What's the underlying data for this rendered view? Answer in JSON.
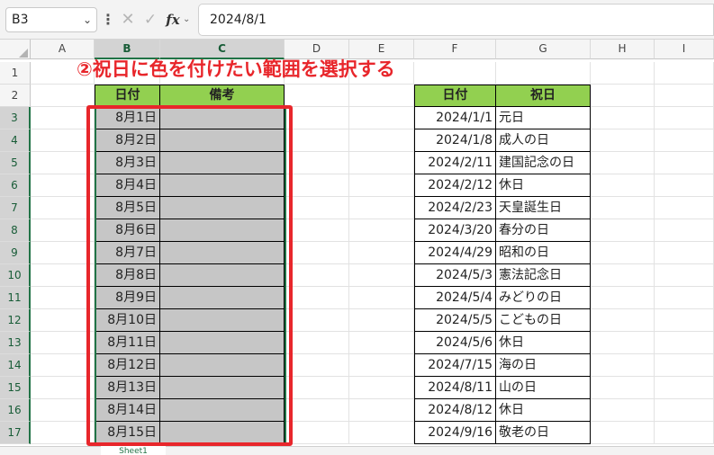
{
  "formula_bar": {
    "name_box": "B3",
    "formula": "2024/8/1",
    "fx_label": "fx"
  },
  "columns": [
    "A",
    "B",
    "C",
    "D",
    "E",
    "F",
    "G",
    "H",
    "I"
  ],
  "rows": [
    "1",
    "2",
    "3",
    "4",
    "5",
    "6",
    "7",
    "8",
    "9",
    "10",
    "11",
    "12",
    "13",
    "14",
    "15",
    "16",
    "17"
  ],
  "annotation": "②祝日に色を付けたい範囲を選択する",
  "left_table": {
    "headers": [
      "日付",
      "備考"
    ],
    "dates": [
      "8月1日",
      "8月2日",
      "8月3日",
      "8月4日",
      "8月5日",
      "8月6日",
      "8月7日",
      "8月8日",
      "8月9日",
      "8月10日",
      "8月11日",
      "8月12日",
      "8月13日",
      "8月14日",
      "8月15日"
    ]
  },
  "right_table": {
    "headers": [
      "日付",
      "祝日"
    ],
    "rows": [
      {
        "date": "2024/1/1",
        "name": "元日"
      },
      {
        "date": "2024/1/8",
        "name": "成人の日"
      },
      {
        "date": "2024/2/11",
        "name": "建国記念の日"
      },
      {
        "date": "2024/2/12",
        "name": "休日"
      },
      {
        "date": "2024/2/23",
        "name": "天皇誕生日"
      },
      {
        "date": "2024/3/20",
        "name": "春分の日"
      },
      {
        "date": "2024/4/29",
        "name": "昭和の日"
      },
      {
        "date": "2024/5/3",
        "name": "憲法記念日"
      },
      {
        "date": "2024/5/4",
        "name": "みどりの日"
      },
      {
        "date": "2024/5/5",
        "name": "こどもの日"
      },
      {
        "date": "2024/5/6",
        "name": "休日"
      },
      {
        "date": "2024/7/15",
        "name": "海の日"
      },
      {
        "date": "2024/8/11",
        "name": "山の日"
      },
      {
        "date": "2024/8/12",
        "name": "休日"
      },
      {
        "date": "2024/9/16",
        "name": "敬老の日"
      }
    ]
  },
  "sheet_tab": "Sheet1",
  "colors": {
    "header_fill": "#92d050",
    "selection": "#c6c6c6",
    "annotation": "#e8262b",
    "accent": "#217346"
  }
}
